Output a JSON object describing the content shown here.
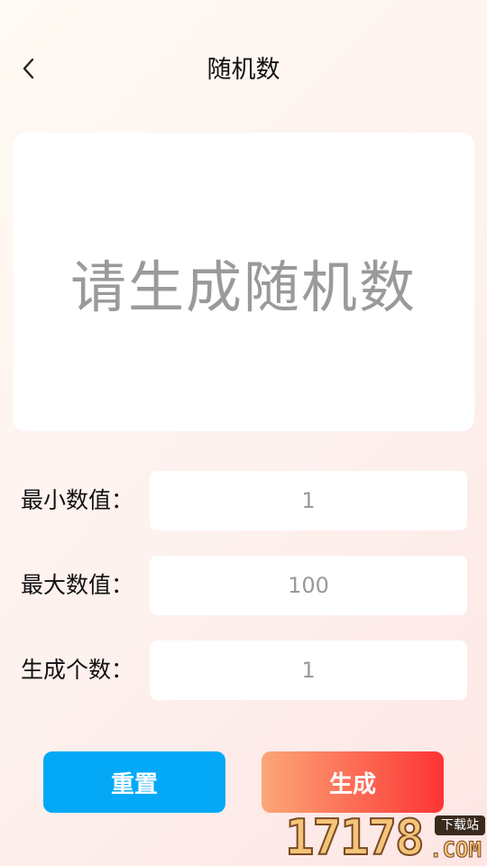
{
  "header": {
    "title": "随机数",
    "back_icon": "chevron-left-icon"
  },
  "result": {
    "placeholder": "请生成随机数"
  },
  "fields": [
    {
      "label": "最小数值：",
      "value": "1"
    },
    {
      "label": "最大数值：",
      "value": "100"
    },
    {
      "label": "生成个数：",
      "value": "1"
    }
  ],
  "buttons": {
    "reset_label": "重置",
    "generate_label": "生成"
  },
  "colors": {
    "reset_button": "#03a9f6",
    "generate_gradient_start": "#fba778",
    "generate_gradient_end": "#fd3434"
  },
  "watermark": {
    "digits": "17178",
    "badge": "下载站",
    "domain": ".COM"
  }
}
